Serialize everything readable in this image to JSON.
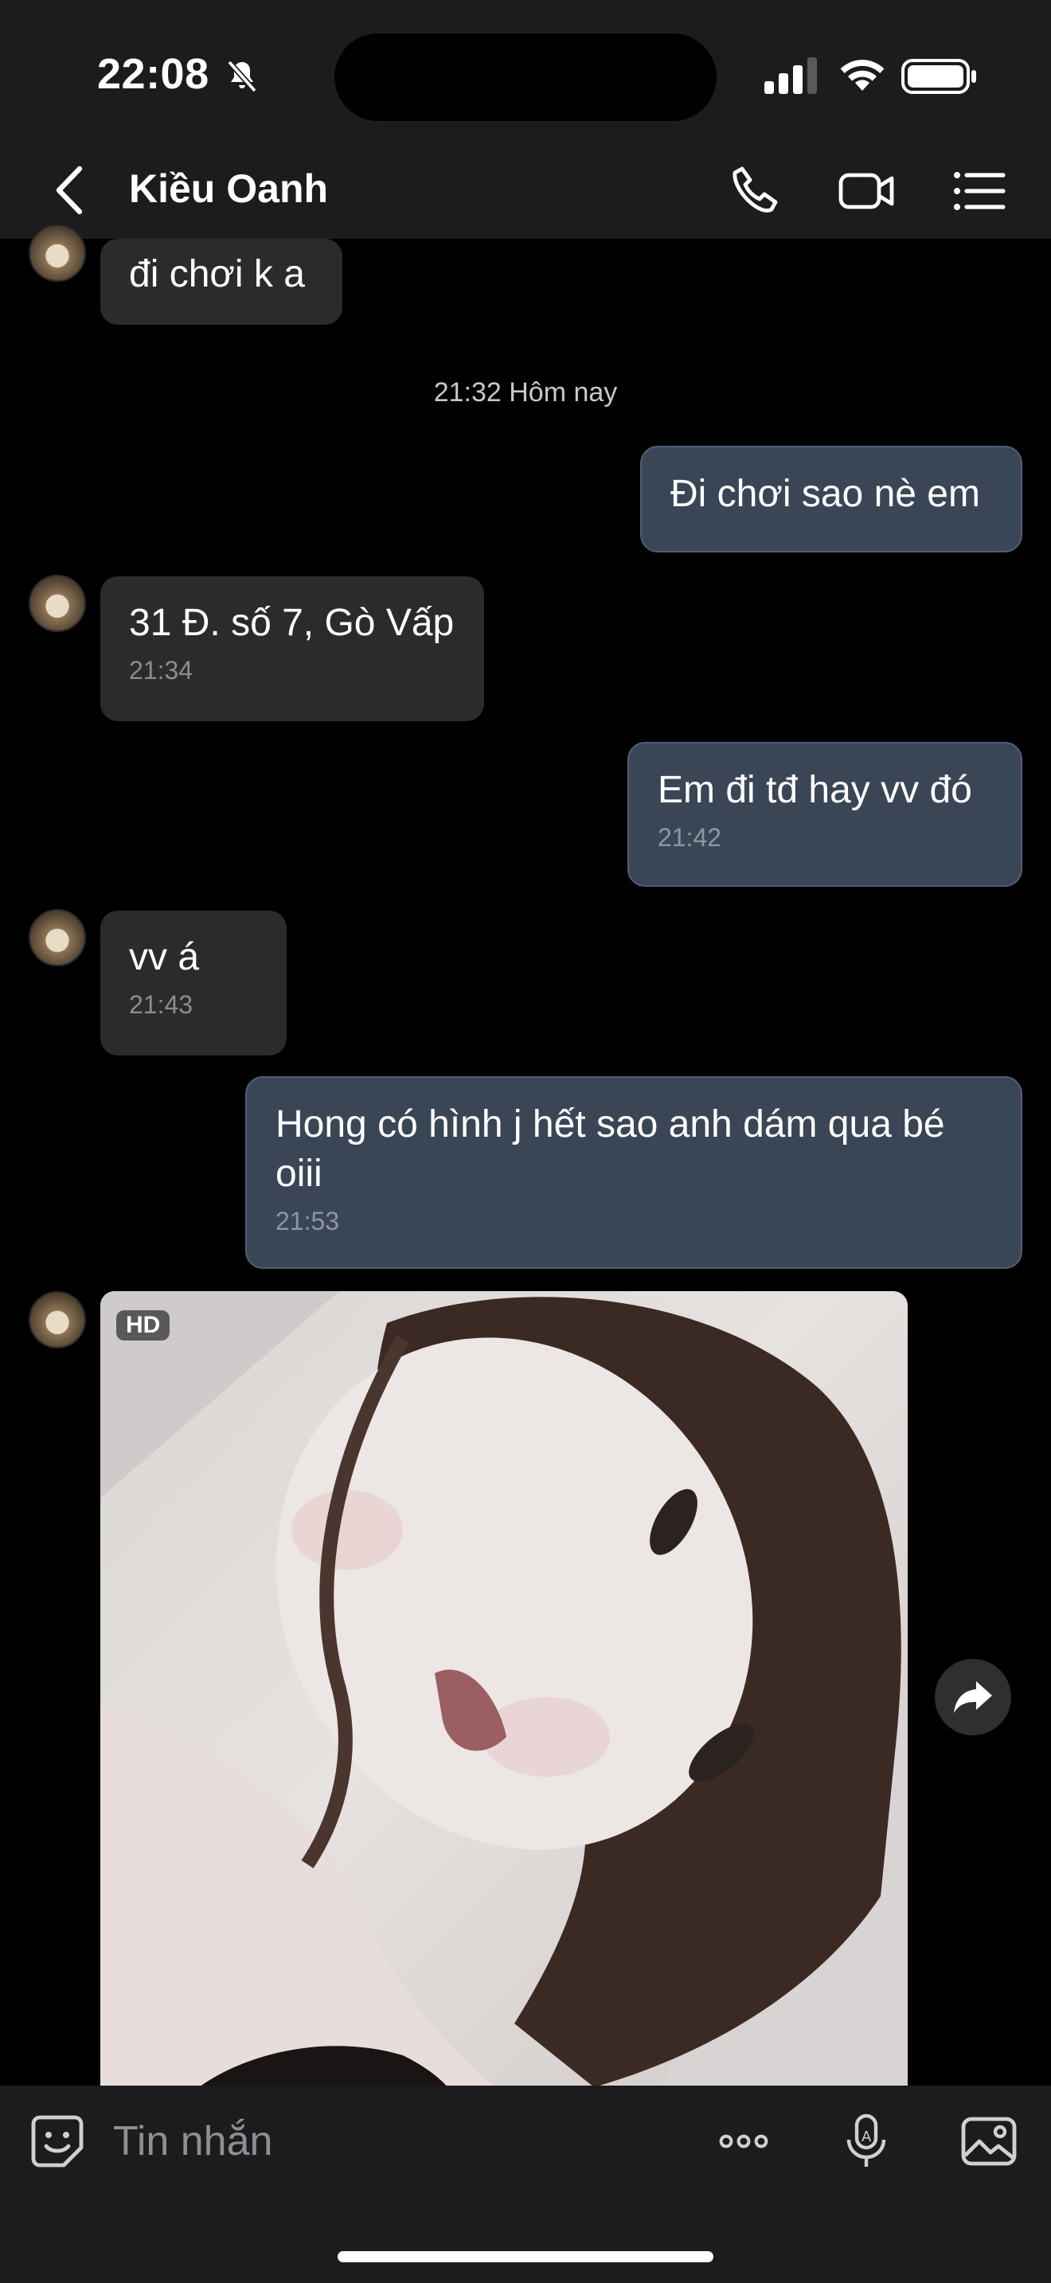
{
  "status": {
    "time": "22:08"
  },
  "header": {
    "contact_name": "Kiều Oanh"
  },
  "messages": {
    "m0": {
      "text": "đi chơi k a"
    },
    "separator": "21:32 Hôm nay",
    "m1": {
      "text": "Đi chơi sao nè em"
    },
    "m2": {
      "text": "31 Đ. số 7, Gò Vấp",
      "time": "21:34"
    },
    "m3": {
      "text": "Em đi tđ hay vv đó",
      "time": "21:42"
    },
    "m4": {
      "text": "vv á",
      "time": "21:43"
    },
    "m5": {
      "text": "Hong có hình j hết sao anh dám qua bé oiii",
      "time": "21:53"
    }
  },
  "photo": {
    "badge": "HD"
  },
  "input": {
    "placeholder": "Tin nhắn"
  },
  "colors": {
    "incoming_bubble": "#2b2b2d",
    "outgoing_bubble": "#3a4656",
    "bar": "#1c1c1e"
  }
}
